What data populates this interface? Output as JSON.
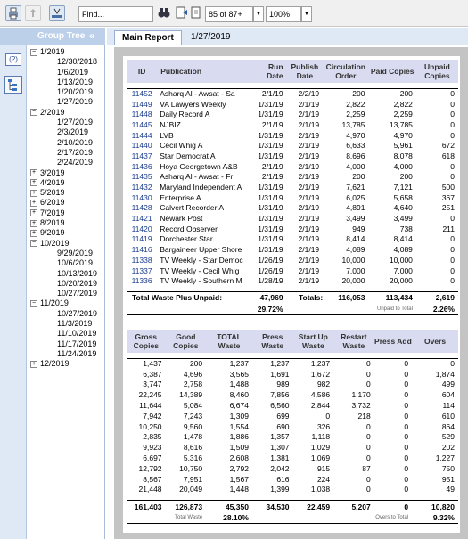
{
  "toolbar": {
    "find_value": "Find...",
    "page_value": "85 of 87+",
    "zoom_value": "100%"
  },
  "sidebar": {
    "title": "Group Tree",
    "collapse_label": "«",
    "help_label": "(?)",
    "tree": [
      {
        "label": "1/2019",
        "toggle": "−",
        "children": [
          "12/30/2018",
          "1/6/2019",
          "1/13/2019",
          "1/20/2019",
          "1/27/2019"
        ]
      },
      {
        "label": "2/2019",
        "toggle": "−",
        "children": [
          "1/27/2019",
          "2/3/2019",
          "2/10/2019",
          "2/17/2019",
          "2/24/2019"
        ]
      },
      {
        "label": "3/2019",
        "toggle": "+",
        "children": []
      },
      {
        "label": "4/2019",
        "toggle": "+",
        "children": []
      },
      {
        "label": "5/2019",
        "toggle": "+",
        "children": []
      },
      {
        "label": "6/2019",
        "toggle": "+",
        "children": []
      },
      {
        "label": "7/2019",
        "toggle": "+",
        "children": []
      },
      {
        "label": "8/2019",
        "toggle": "+",
        "children": []
      },
      {
        "label": "9/2019",
        "toggle": "+",
        "children": []
      },
      {
        "label": "10/2019",
        "toggle": "−",
        "children": [
          "9/29/2019",
          "10/6/2019",
          "10/13/2019",
          "10/20/2019",
          "10/27/2019"
        ]
      },
      {
        "label": "11/2019",
        "toggle": "−",
        "children": [
          "10/27/2019",
          "11/3/2019",
          "11/10/2019",
          "11/17/2019",
          "11/24/2019"
        ]
      },
      {
        "label": "12/2019",
        "toggle": "+",
        "children": []
      }
    ]
  },
  "tabs": {
    "main_report": "Main Report",
    "date_tab": "1/27/2019"
  },
  "table1": {
    "headers": [
      "ID",
      "Publication",
      "Run Date",
      "Publish Date",
      "Circulation Order",
      "Paid Copies",
      "Unpaid Copies"
    ],
    "rows": [
      [
        "11452",
        "Asharq Al - Awsat - Sa",
        "2/1/19",
        "2/2/19",
        "200",
        "200",
        "0"
      ],
      [
        "11449",
        "VA Lawyers Weekly",
        "1/31/19",
        "2/1/19",
        "2,822",
        "2,822",
        "0"
      ],
      [
        "11448",
        "Daily Record A",
        "1/31/19",
        "2/1/19",
        "2,259",
        "2,259",
        "0"
      ],
      [
        "11445",
        "NJBIZ",
        "2/1/19",
        "2/1/19",
        "13,785",
        "13,785",
        "0"
      ],
      [
        "11444",
        "LVB",
        "1/31/19",
        "2/1/19",
        "4,970",
        "4,970",
        "0"
      ],
      [
        "11440",
        "Cecil Whig A",
        "1/31/19",
        "2/1/19",
        "6,633",
        "5,961",
        "672"
      ],
      [
        "11437",
        "Star Democrat A",
        "1/31/19",
        "2/1/19",
        "8,696",
        "8,078",
        "618"
      ],
      [
        "11436",
        "Hoya Georgetown A&B",
        "2/1/19",
        "2/1/19",
        "4,000",
        "4,000",
        "0"
      ],
      [
        "11435",
        "Asharq Al - Awsat - Fr",
        "2/1/19",
        "2/1/19",
        "200",
        "200",
        "0"
      ],
      [
        "11432",
        "Maryland Independent A",
        "1/31/19",
        "2/1/19",
        "7,621",
        "7,121",
        "500"
      ],
      [
        "11430",
        "Enterprise A",
        "1/31/19",
        "2/1/19",
        "6,025",
        "5,658",
        "367"
      ],
      [
        "11428",
        "Calvert Recorder A",
        "1/31/19",
        "2/1/19",
        "4,891",
        "4,640",
        "251"
      ],
      [
        "11421",
        "Newark Post",
        "1/31/19",
        "2/1/19",
        "3,499",
        "3,499",
        "0"
      ],
      [
        "11420",
        "Record Observer",
        "1/31/19",
        "2/1/19",
        "949",
        "738",
        "211"
      ],
      [
        "11419",
        "Dorchester Star",
        "1/31/19",
        "2/1/19",
        "8,414",
        "8,414",
        "0"
      ],
      [
        "11416",
        "Bargaineer Upper Shore",
        "1/31/19",
        "2/1/19",
        "4,089",
        "4,089",
        "0"
      ],
      [
        "11338",
        "TV Weekly - Star Democ",
        "1/26/19",
        "2/1/19",
        "10,000",
        "10,000",
        "0"
      ],
      [
        "11337",
        "TV Weekly - Cecil Whig",
        "1/26/19",
        "2/1/19",
        "7,000",
        "7,000",
        "0"
      ],
      [
        "11336",
        "TV Weekly - Southern M",
        "1/28/19",
        "2/1/19",
        "20,000",
        "20,000",
        "0"
      ]
    ],
    "total_label": "Total Waste Plus Unpaid:",
    "total_waste_value": "47,969",
    "total_waste_pct": "29.72%",
    "totals_label": "Totals:",
    "totals_circ": "116,053",
    "totals_paid": "113,434",
    "totals_unpaid": "2,619",
    "unpaid_to_total_label": "Unpaid to Total",
    "unpaid_to_total_pct": "2.26%"
  },
  "table2": {
    "headers": [
      "Gross Copies",
      "Good Copies",
      "TOTAL Waste",
      "Press Waste",
      "Start Up Waste",
      "Restart Waste",
      "Press Add",
      "Overs"
    ],
    "rows": [
      [
        "1,437",
        "200",
        "1,237",
        "1,237",
        "1,237",
        "0",
        "0",
        "0"
      ],
      [
        "6,387",
        "4,696",
        "3,565",
        "1,691",
        "1,672",
        "0",
        "0",
        "1,874"
      ],
      [
        "3,747",
        "2,758",
        "1,488",
        "989",
        "982",
        "0",
        "0",
        "499"
      ],
      [
        "22,245",
        "14,389",
        "8,460",
        "7,856",
        "4,586",
        "1,170",
        "0",
        "604"
      ],
      [
        "11,644",
        "5,084",
        "6,674",
        "6,560",
        "2,844",
        "3,732",
        "0",
        "114"
      ],
      [
        "7,942",
        "7,243",
        "1,309",
        "699",
        "0",
        "218",
        "0",
        "610"
      ],
      [
        "10,250",
        "9,560",
        "1,554",
        "690",
        "326",
        "0",
        "0",
        "864"
      ],
      [
        "2,835",
        "1,478",
        "1,886",
        "1,357",
        "1,118",
        "0",
        "0",
        "529"
      ],
      [
        "9,923",
        "8,616",
        "1,509",
        "1,307",
        "1,029",
        "0",
        "0",
        "202"
      ],
      [
        "6,697",
        "5,316",
        "2,608",
        "1,381",
        "1,069",
        "0",
        "0",
        "1,227"
      ],
      [
        "12,792",
        "10,750",
        "2,792",
        "2,042",
        "915",
        "87",
        "0",
        "750"
      ],
      [
        "8,567",
        "7,951",
        "1,567",
        "616",
        "224",
        "0",
        "0",
        "951"
      ],
      [
        "21,448",
        "20,049",
        "1,448",
        "1,399",
        "1,038",
        "0",
        "0",
        "49"
      ]
    ],
    "totals": [
      "161,403",
      "126,873",
      "45,350",
      "34,530",
      "22,459",
      "5,207",
      "0",
      "10,820"
    ],
    "total_waste_label": "Total Waste",
    "total_waste_pct": "28.10%",
    "overs_to_total_label": "Overs to Total",
    "overs_to_total_pct": "9.32%"
  }
}
